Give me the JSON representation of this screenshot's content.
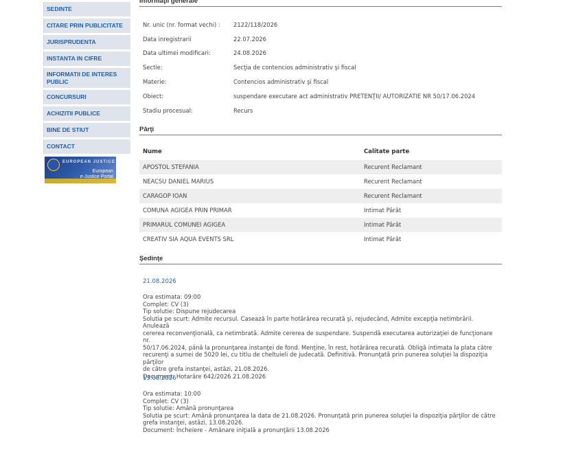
{
  "sidebar": {
    "items": [
      {
        "label": "SEDINTE"
      },
      {
        "label": "CITARE PRIN PUBLICITATE"
      },
      {
        "label": "JURISPRUDENTA"
      },
      {
        "label": "INSTANTA IN CIFRE"
      },
      {
        "label": "INFORMATII DE INTERES PUBLIC"
      },
      {
        "label": "CONCURSURI"
      },
      {
        "label": "ACHIZITII PUBLICE"
      },
      {
        "label": "BINE DE STIUT"
      },
      {
        "label": "CONTACT"
      }
    ],
    "banner": {
      "top_text": "EUROPEAN JUSTICE",
      "line1": "European",
      "line2": "e-Justice Portal"
    }
  },
  "general": {
    "title": "Informaţii generale",
    "rows": [
      {
        "label": "Nr. unic (nr. format vechi) :",
        "value": "2122/118/2026"
      },
      {
        "label": "Data inregistrarii",
        "value": "22.07.2026"
      },
      {
        "label": "Data ultimei modificari:",
        "value": "24.08.2026"
      },
      {
        "label": "Sectie:",
        "value": "Secţia de contencios administrativ şi fiscal"
      },
      {
        "label": "Materie:",
        "value": "Contencios administrativ şi fiscal"
      },
      {
        "label": "Obiect:",
        "value": "suspendare executare act administrativ PRETENŢII/ AUTORIZATIE NR 50/17.06.2024"
      },
      {
        "label": "Stadiu procesual:",
        "value": "Recurs"
      }
    ]
  },
  "parties": {
    "title": "Părţi",
    "columns": [
      "Nume",
      "Calitate parte"
    ],
    "rows": [
      {
        "name": "APOSTOL STEFANIA",
        "role": "Recurent Reclamant"
      },
      {
        "name": "NEACSU DANIEL MARIUS",
        "role": "Recurent Reclamant"
      },
      {
        "name": "CARAGOP IOAN",
        "role": "Recurent Reclamant"
      },
      {
        "name": "COMUNA AGIGEA PRIN PRIMAR",
        "role": "Intimat Pârât"
      },
      {
        "name": "PRIMARUL COMUNEI AGIGEA",
        "role": "Intimat Pârât"
      },
      {
        "name": "CREATIV SIA AQUA EVENTS SRL",
        "role": "Intimat Pârât"
      }
    ]
  },
  "sessions": {
    "title": "Şedinţe",
    "items": [
      {
        "date": "21.08.2026",
        "lines": [
          "Ora estimata: 09:00",
          "Complet: CV (3)",
          "Tip solutie: Dispune rejudecarea",
          "Solutia pe scurt: Admite recursul. Casează în parte hotărârea recurată şi, rejudecând, Admite excepţia netimbrării. Anulează",
          "cererea reconvenţională, ca netimbrată. Admite cererea de suspendare. Suspendă executarea autorizaţiei de funcţionare nr.",
          "50/17.06.2024, până la pronunţarea instanţei de fond. Menţine, în rest, hotărârea recurată. Obligă intimata la plata către",
          "recurenţi a sumei de 5020 lei, cu titlu de cheltuieli de judecată. Definitivă. Pronunţată prin punerea soluţiei la dispoziţia părţilor",
          "de către grefa instanţei, astăzi, 21.08.2026.",
          "Document: Hotarâre  642/2026  21.08.2026"
        ]
      },
      {
        "date": "13.08.2026",
        "lines": [
          "Ora estimata: 10:00",
          "Complet: CV (3)",
          "Tip solutie: Amână pronunţarea",
          "Solutia pe scurt: Amână pronunţarea la data de 21.08.2026. Pronunţată prin punerea soluţiei la dispoziţia părţilor de către",
          "grefa instanţei, astăzi, 13.08.2026.",
          "Document: Încheiere - Amânare iniţială a pronunţării     13.08.2026"
        ]
      }
    ]
  }
}
